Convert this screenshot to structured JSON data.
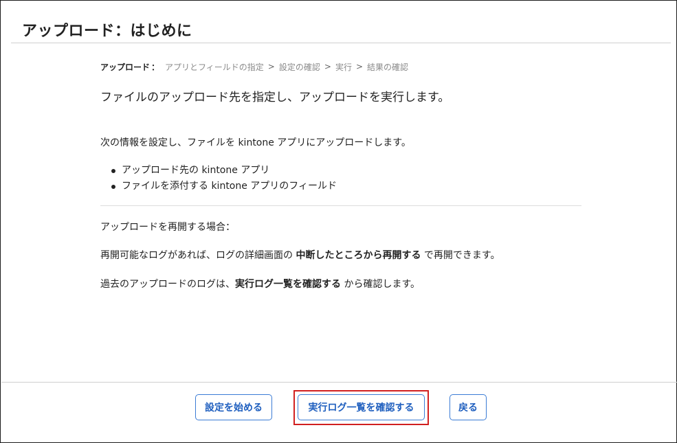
{
  "page": {
    "title": "アップロード：はじめに"
  },
  "breadcrumb": {
    "current": "アップロード",
    "colon": "：",
    "separator": ">",
    "steps": [
      "アプリとフィールドの指定",
      "設定の確認",
      "実行",
      "結果の確認"
    ]
  },
  "content": {
    "lead": "ファイルのアップロード先を指定し、アップロードを実行します。",
    "intro": "次の情報を設定し、ファイルを kintone アプリにアップロードします。",
    "bullets": [
      "アップロード先の kintone アプリ",
      "ファイルを添付する kintone アプリのフィールド"
    ],
    "resume_heading": "アップロードを再開する場合：",
    "resume_line": {
      "prefix": "再開可能なログがあれば、ログの詳細画面の ",
      "bold": "中断したところから再開する",
      "suffix": " で再開できます。"
    },
    "past_line": {
      "prefix": "過去のアップロードのログは、",
      "bold": "実行ログ一覧を確認する",
      "suffix": " から確認します。"
    }
  },
  "footer": {
    "start_button": "設定を始める",
    "log_button": "実行ログ一覧を確認する",
    "back_button": "戻る"
  },
  "colors": {
    "button_border": "#3a7bd5",
    "button_text": "#1f5fbf",
    "highlight": "#d11f1f"
  }
}
